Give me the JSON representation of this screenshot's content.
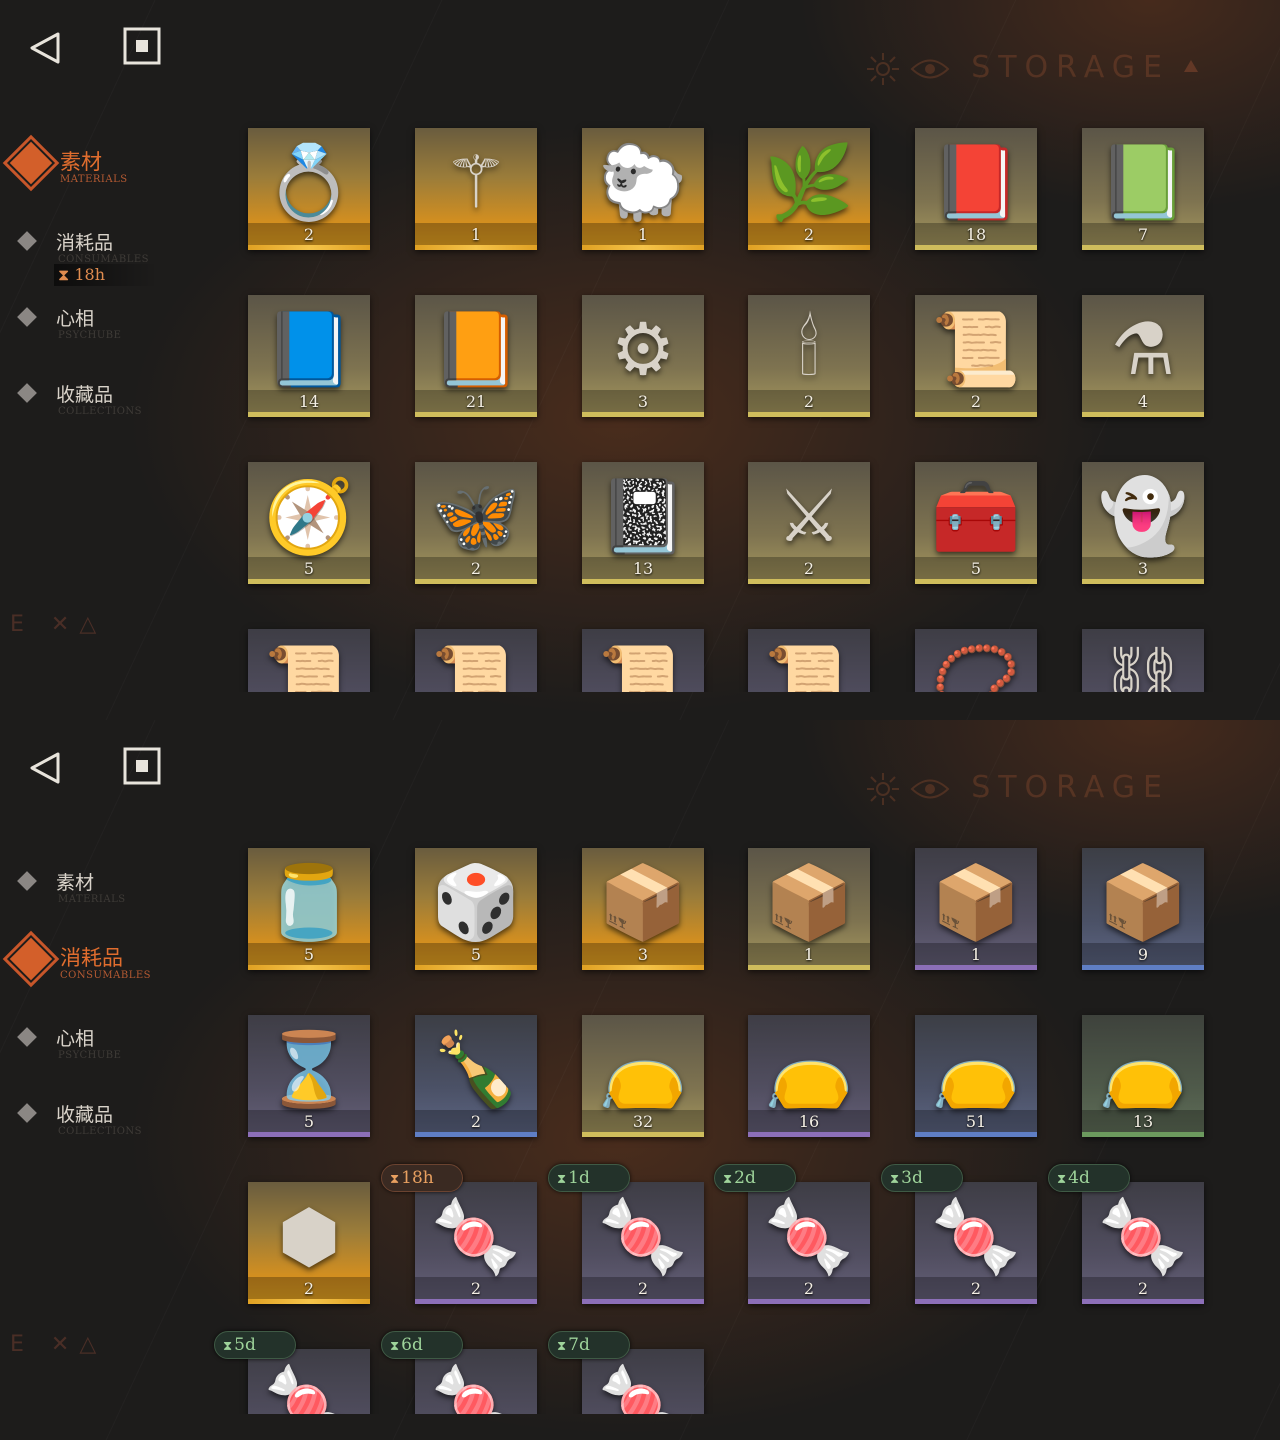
{
  "nav": {
    "back": "◁",
    "home": "▣"
  },
  "watermark": "STORAGE",
  "side_glyphs": "E ✕△",
  "tabs": [
    {
      "label": "素材",
      "sub": "MATERIALS"
    },
    {
      "label": "消耗品",
      "sub": "CONSUMABLES"
    },
    {
      "label": "心相",
      "sub": "PSYCHUBE"
    },
    {
      "label": "收藏品",
      "sub": "COLLECTIONS"
    }
  ],
  "timer": {
    "icon": "hourglass-icon",
    "text": "18h"
  },
  "colors": {
    "accent": "#e06d2e",
    "gold": "#e7a622",
    "purple": "#8c6fb8",
    "blue": "#5f7ec4",
    "green": "#6c9a5e"
  },
  "screens": [
    {
      "active_tab": 0,
      "items": [
        {
          "icon": "ring-icon",
          "glyph": "💍",
          "rarity": "gold",
          "qty": "2"
        },
        {
          "icon": "caduceus-icon",
          "glyph": "⚚",
          "rarity": "gold",
          "qty": "1"
        },
        {
          "icon": "sheep-figure-icon",
          "glyph": "🐑",
          "rarity": "gold",
          "qty": "1"
        },
        {
          "icon": "laurel-wreath-icon",
          "glyph": "🌿",
          "rarity": "gold",
          "qty": "2"
        },
        {
          "icon": "red-rune-book-icon",
          "glyph": "📕",
          "rarity": "yellow",
          "qty": "18"
        },
        {
          "icon": "green-rune-book-icon",
          "glyph": "📗",
          "rarity": "yellow",
          "qty": "7"
        },
        {
          "icon": "blue-rune-book-icon",
          "glyph": "📘",
          "rarity": "yellow",
          "qty": "14"
        },
        {
          "icon": "gold-rune-book-icon",
          "glyph": "📙",
          "rarity": "yellow",
          "qty": "21"
        },
        {
          "icon": "astrolabe-icon",
          "glyph": "⚙",
          "rarity": "yellow",
          "qty": "3"
        },
        {
          "icon": "ouija-board-icon",
          "glyph": "🕯",
          "rarity": "yellow",
          "qty": "2"
        },
        {
          "icon": "green-tablet-icon",
          "glyph": "📜",
          "rarity": "yellow",
          "qty": "2"
        },
        {
          "icon": "potion-bottle-icon",
          "glyph": "⚗",
          "rarity": "yellow",
          "qty": "4"
        },
        {
          "icon": "compass-icon",
          "glyph": "🧭",
          "rarity": "yellow",
          "qty": "5"
        },
        {
          "icon": "firefly-icon",
          "glyph": "🦋",
          "rarity": "yellow",
          "qty": "2"
        },
        {
          "icon": "dark-tome-icon",
          "glyph": "📓",
          "rarity": "yellow",
          "qty": "13"
        },
        {
          "icon": "blades-icon",
          "glyph": "⚔",
          "rarity": "yellow",
          "qty": "2"
        },
        {
          "icon": "hand-chest-icon",
          "glyph": "🧰",
          "rarity": "yellow",
          "qty": "5"
        },
        {
          "icon": "ghost-icon",
          "glyph": "👻",
          "rarity": "yellow",
          "qty": "3"
        },
        {
          "icon": "red-scroll-icon",
          "glyph": "📜",
          "rarity": "purple",
          "qty": ""
        },
        {
          "icon": "green-scroll-icon",
          "glyph": "📜",
          "rarity": "purple",
          "qty": ""
        },
        {
          "icon": "blue-scroll-icon",
          "glyph": "📜",
          "rarity": "purple",
          "qty": ""
        },
        {
          "icon": "gold-scroll-icon",
          "glyph": "📜",
          "rarity": "purple",
          "qty": ""
        },
        {
          "icon": "amulet-icon",
          "glyph": "📿",
          "rarity": "purple",
          "qty": ""
        },
        {
          "icon": "chain-icon",
          "glyph": "⛓",
          "rarity": "purple",
          "qty": ""
        }
      ]
    },
    {
      "active_tab": 1,
      "items": [
        {
          "icon": "candy-jar-icon",
          "glyph": "🫙",
          "rarity": "gold",
          "qty": "5"
        },
        {
          "icon": "rune-cube-icon",
          "glyph": "🎲",
          "rarity": "gold",
          "qty": "5"
        },
        {
          "icon": "wooden-crate-icon",
          "glyph": "📦",
          "rarity": "gold",
          "qty": "3"
        },
        {
          "icon": "wooden-crate-icon",
          "glyph": "📦",
          "rarity": "yellow",
          "qty": "1"
        },
        {
          "icon": "wooden-crate-icon",
          "glyph": "📦",
          "rarity": "purple",
          "qty": "1"
        },
        {
          "icon": "wooden-crate-icon",
          "glyph": "📦",
          "rarity": "blue",
          "qty": "9"
        },
        {
          "icon": "hourglass-item-icon",
          "glyph": "⌛",
          "rarity": "purple",
          "qty": "5"
        },
        {
          "icon": "message-bottle-icon",
          "glyph": "🍾",
          "rarity": "blue",
          "qty": "2"
        },
        {
          "icon": "parcel-icon",
          "glyph": "👝",
          "rarity": "yellow",
          "qty": "32"
        },
        {
          "icon": "parcel-icon",
          "glyph": "👝",
          "rarity": "purple",
          "qty": "16"
        },
        {
          "icon": "parcel-icon",
          "glyph": "👝",
          "rarity": "blue",
          "qty": "51"
        },
        {
          "icon": "parcel-icon",
          "glyph": "👝",
          "rarity": "green",
          "qty": "13"
        },
        {
          "icon": "hex-badge-icon",
          "glyph": "⬢",
          "rarity": "gold",
          "qty": "2"
        },
        {
          "icon": "candy-icon",
          "glyph": "🍬",
          "rarity": "purple",
          "qty": "2",
          "timer": "18h",
          "timer_style": "orange"
        },
        {
          "icon": "candy-icon",
          "glyph": "🍬",
          "rarity": "purple",
          "qty": "2",
          "timer": "1d",
          "timer_style": "green"
        },
        {
          "icon": "candy-icon",
          "glyph": "🍬",
          "rarity": "purple",
          "qty": "2",
          "timer": "2d",
          "timer_style": "green"
        },
        {
          "icon": "candy-icon",
          "glyph": "🍬",
          "rarity": "purple",
          "qty": "2",
          "timer": "3d",
          "timer_style": "green"
        },
        {
          "icon": "candy-icon",
          "glyph": "🍬",
          "rarity": "purple",
          "qty": "2",
          "timer": "4d",
          "timer_style": "green"
        },
        {
          "icon": "candy-icon",
          "glyph": "🍬",
          "rarity": "purple",
          "qty": "",
          "timer": "5d",
          "timer_style": "green"
        },
        {
          "icon": "candy-icon",
          "glyph": "🍬",
          "rarity": "purple",
          "qty": "",
          "timer": "6d",
          "timer_style": "green"
        },
        {
          "icon": "candy-icon",
          "glyph": "🍬",
          "rarity": "purple",
          "qty": "",
          "timer": "7d",
          "timer_style": "green"
        }
      ]
    }
  ]
}
